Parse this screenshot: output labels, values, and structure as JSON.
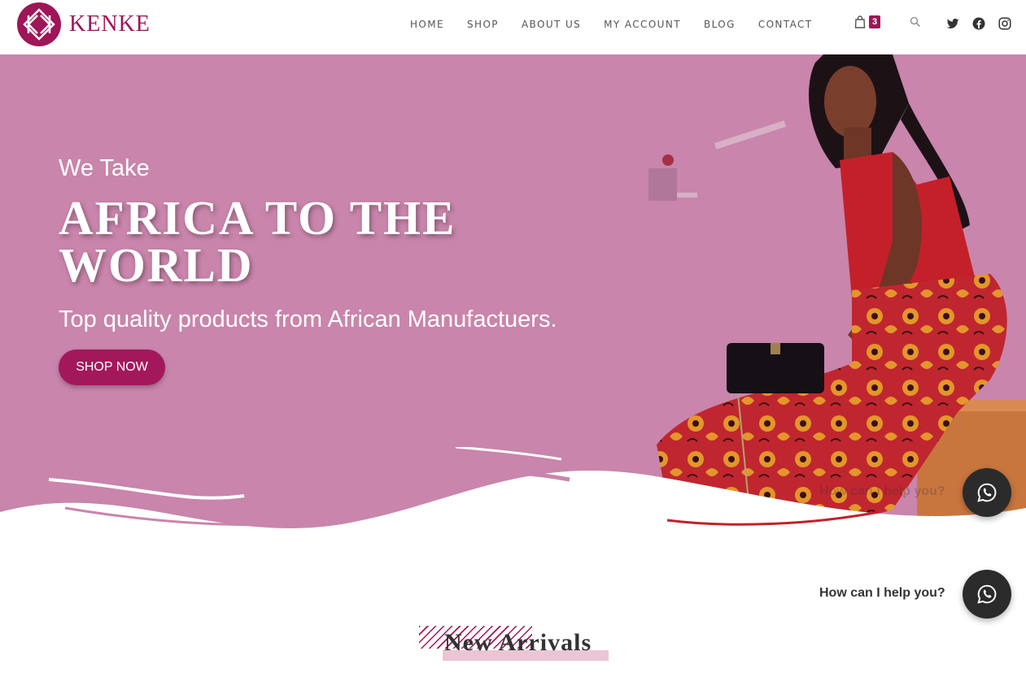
{
  "brand": {
    "name": "KENKE",
    "logo_icon": "kenke-logo-icon",
    "accent": "#9e1558"
  },
  "nav": {
    "items": [
      {
        "label": "HOME"
      },
      {
        "label": "SHOP"
      },
      {
        "label": "ABOUT US"
      },
      {
        "label": "MY ACCOUNT"
      },
      {
        "label": "BLOG"
      },
      {
        "label": "CONTACT"
      }
    ],
    "cart_icon": "shopping-bag-icon",
    "cart_count": "3",
    "search_icon": "search-icon",
    "social": [
      "twitter-icon",
      "facebook-icon",
      "instagram-icon"
    ]
  },
  "hero": {
    "kicker": "We Take",
    "title": "AFRICA TO THE WORLD",
    "subtitle": "Top quality products from African Manufactuers.",
    "cta_label": "SHOP NOW",
    "background_color": "#c985ab",
    "cta_color": "#a3185b"
  },
  "whatsapp": {
    "icon": "whatsapp-icon",
    "prompt": "How can I help you?",
    "prompt_faded": "How can I help you?"
  },
  "section": {
    "title": "New Arrivals"
  }
}
